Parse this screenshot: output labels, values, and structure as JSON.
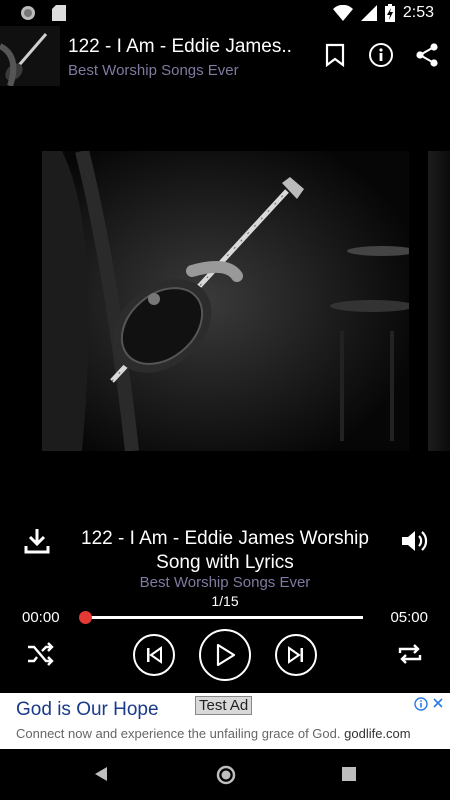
{
  "status_bar": {
    "time": "2:53"
  },
  "header": {
    "title": "122 - I Am - Eddie James..",
    "subtitle": "Best Worship Songs Ever",
    "icons": [
      "bookmark-icon",
      "info-icon",
      "share-icon"
    ]
  },
  "player": {
    "title": "122 - I Am - Eddie James Worship Song with Lyrics",
    "subtitle": "Best Worship Songs Ever",
    "track_counter": "1/15",
    "time_elapsed": "00:00",
    "time_total": "05:00",
    "progress": 0.0,
    "accent_color": "#e53935",
    "subtitle_color": "#7f7aa0"
  },
  "ad": {
    "badge": "Test Ad",
    "title": "God is Our Hope",
    "body": "Connect now and experience the unfailing grace of God.",
    "domain": "godlife.com"
  }
}
